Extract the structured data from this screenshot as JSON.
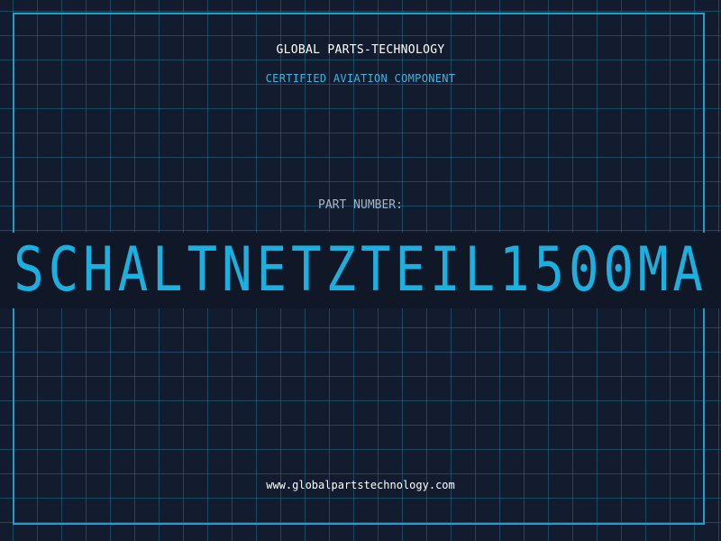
{
  "header": {
    "company": "GLOBAL PARTS-TECHNOLOGY",
    "subtitle": "CERTIFIED AVIATION COMPONENT"
  },
  "part": {
    "label": "PART NUMBER:",
    "number": "SCHALTNETZTEIL1500MA"
  },
  "footer": {
    "url": "www.globalpartstechnology.com"
  },
  "colors": {
    "background": "#131c2e",
    "accent": "#1cb0e0",
    "grid": "#1e6e8c"
  }
}
